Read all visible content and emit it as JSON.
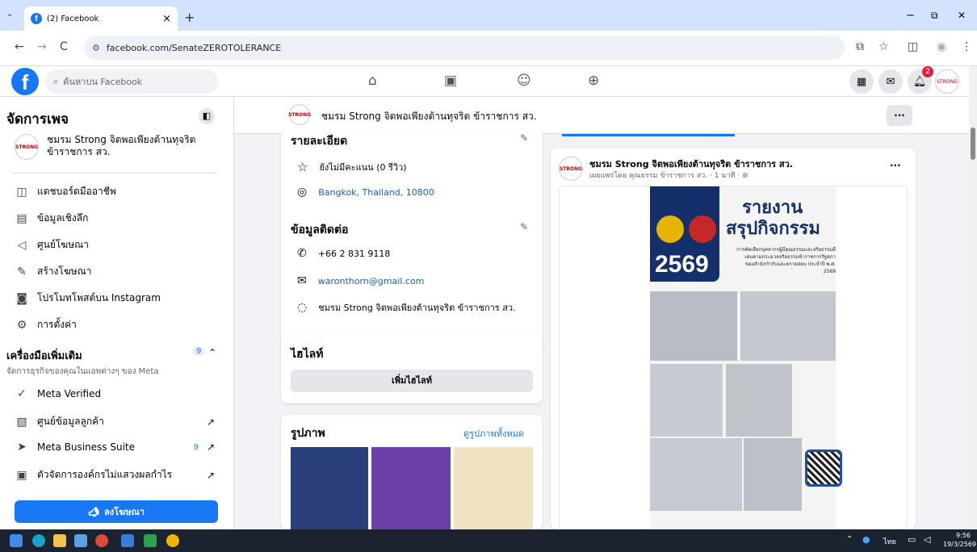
{
  "browser": {
    "tab_title": "(2) Facebook",
    "tab_close": "×",
    "new_tab": "+",
    "url": "facebook.com/SenateZEROTOLERANCE",
    "back": "←",
    "forward": "→",
    "reload": "C",
    "win_min": "−",
    "win_max": "⧉",
    "win_close": "✕"
  },
  "fb": {
    "logo": "f",
    "search_placeholder": "ค้นหาบน Facebook",
    "notif_count": "2"
  },
  "sidebar": {
    "title": "จัดการเพจ",
    "page_name": "ชมรม Strong จิตพอเพียงต้านทุจริต ข้าราชการ สว.",
    "items": [
      {
        "icon": "dashboard-icon",
        "label": "แดชบอร์ดมืออาชีพ"
      },
      {
        "icon": "insights-icon",
        "label": "ข้อมูลเชิงลึก"
      },
      {
        "icon": "megaphone-icon",
        "label": "ศูนย์โฆษณา"
      },
      {
        "icon": "pencil-icon",
        "label": "สร้างโฆษณา"
      },
      {
        "icon": "instagram-icon",
        "label": "โปรโมทโพสต์บน Instagram"
      },
      {
        "icon": "gear-icon",
        "label": "การตั้งค่า"
      }
    ],
    "tools_title": "เครื่องมือเพิ่มเติม",
    "tools_count": "9",
    "tools_sub": "จัดการธุรกิจของคุณในแอพต่างๆ ของ Meta",
    "tools": [
      {
        "icon": "verified-icon",
        "label": "Meta Verified",
        "badge": "",
        "ext": ""
      },
      {
        "icon": "contacts-icon",
        "label": "ศูนย์ข้อมูลลูกค้า",
        "badge": "",
        "ext": "↗"
      },
      {
        "icon": "business-suite-icon",
        "label": "Meta Business Suite",
        "badge": "9",
        "ext": "↗"
      },
      {
        "icon": "nonprofit-icon",
        "label": "ตัวจัดการองค์กรไม่แสวงผลกำไร",
        "badge": "",
        "ext": "↗"
      }
    ],
    "ad_button": "ลงโฆษณา"
  },
  "pagebar": {
    "name": "ชมรม Strong จิตพอเพียงต้านทุจริต ข้าราชการ สว.",
    "more": "···"
  },
  "details": {
    "title": "รายละเอียด",
    "rating": "ยังไม่มีคะแนน (0 รีวิว)",
    "location": "Bangkok, Thailand, 10800"
  },
  "contact": {
    "title": "ข้อมูลติดต่อ",
    "phone": "+66 2 831 9118",
    "email": "waronthorn@gmail.com",
    "messenger": "ชมรม Strong จิตพอเพียงต้านทุจริต ข้าราชการ สว."
  },
  "highlights": {
    "title": "ไฮไลท์",
    "button": "เพิ่มไฮไลท์"
  },
  "photos": {
    "title": "รูปภาพ",
    "see_all": "ดูรูปภาพทั้งหมด"
  },
  "post": {
    "author": "ชมรม Strong จิตพอเพียงต้านทุจริต ข้าราชการ สว.",
    "meta": "เผยแพร่โดย คุณธรรม ข้าราชการ สว. · 1 นาที ·",
    "more": "···",
    "img_title1": "รายงาน",
    "img_title2": "สรุปกิจกรรม",
    "img_year": "2569",
    "img_desc": "การคัดเลือกบุคลากรผู้มีคุณธรรมและจริยธรรมดีเด่นตามประมวลจริยธรรมข้าราชการรัฐสภา ของสำนักกำกับและตรวจสอบ ประจำปี พ.ศ. 2569"
  },
  "taskbar": {
    "lang": "ไทย",
    "time": "9:56",
    "date": "19/3/2569"
  },
  "colors": {
    "fb_blue": "#1877f2",
    "tab_bg": "#d3e3fd",
    "post_navy": "#14306b"
  }
}
